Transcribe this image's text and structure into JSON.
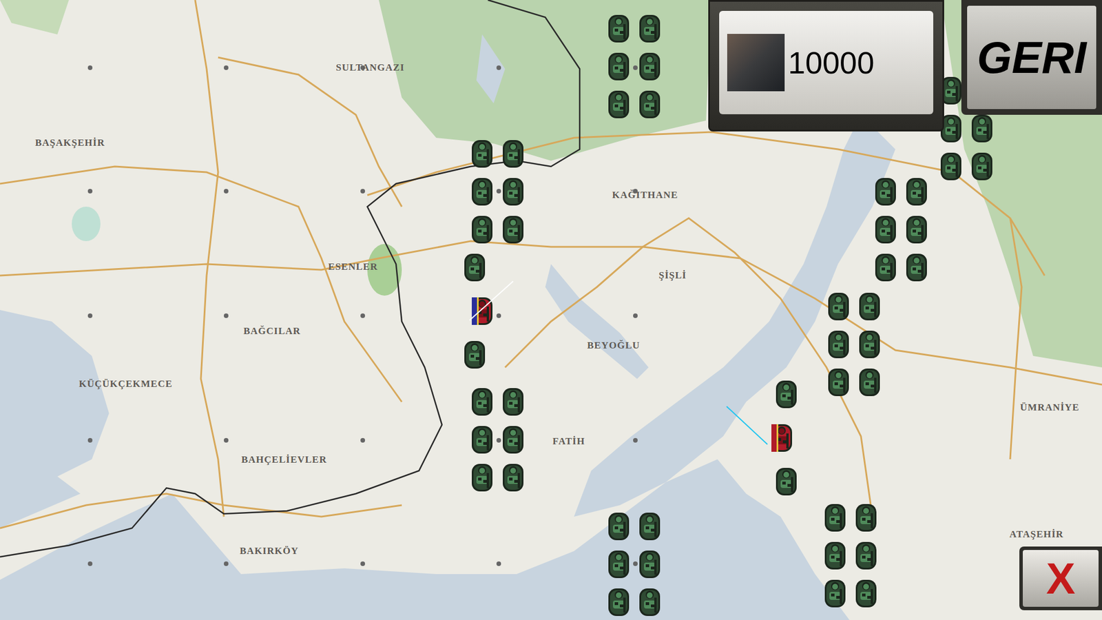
{
  "hud": {
    "credits": "10000",
    "back_button": "GERI",
    "close_button": "X"
  },
  "districts": [
    "SULTANGAZI",
    "BAŞAKŞEHİR",
    "ESENLER",
    "KAĞITHANE",
    "ŞİŞLİ",
    "BAĞCILAR",
    "BEYOĞLU",
    "KÜÇÜKÇEKMECE",
    "FATİH",
    "BAHÇELİEVLER",
    "BAKIRKÖY",
    "ÜMRANİYE",
    "ATAŞEHİR"
  ],
  "units": [
    {
      "kind": "squad"
    },
    {
      "kind": "squad"
    },
    {
      "kind": "column",
      "commander_flag": "#2b2f9a",
      "order_line_color": "#ffffff"
    },
    {
      "kind": "squad"
    },
    {
      "kind": "squad"
    },
    {
      "kind": "squad"
    },
    {
      "kind": "squad"
    },
    {
      "kind": "squad"
    },
    {
      "kind": "column",
      "commander_flag": "#b01c2a",
      "order_line_color": "#22c5f0"
    },
    {
      "kind": "squad"
    }
  ]
}
